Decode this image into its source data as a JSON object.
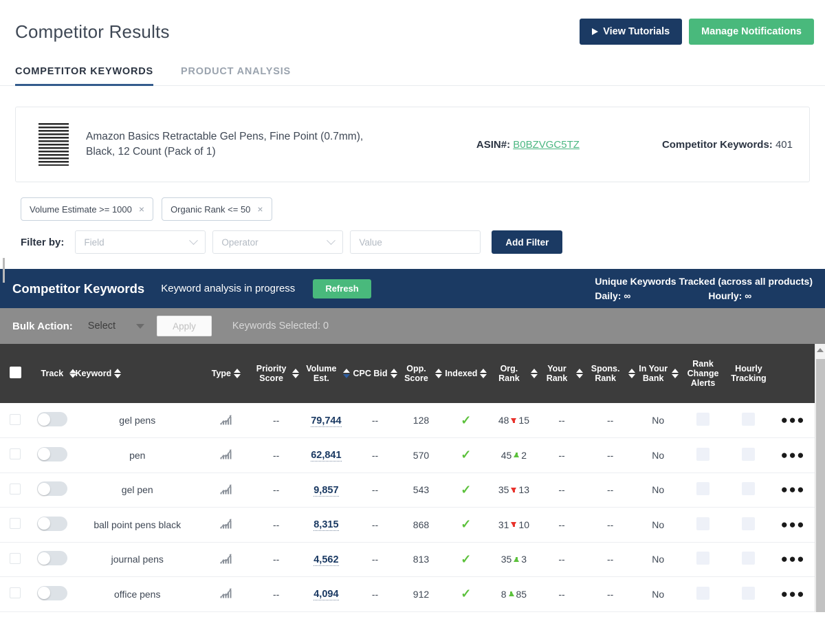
{
  "header": {
    "title": "Competitor Results",
    "tutorials_label": "View Tutorials",
    "notifications_label": "Manage Notifications"
  },
  "tabs": [
    {
      "label": "COMPETITOR KEYWORDS",
      "active": true
    },
    {
      "label": "PRODUCT ANALYSIS",
      "active": false
    }
  ],
  "product": {
    "title": "Amazon Basics Retractable Gel Pens, Fine Point (0.7mm), Black, 12 Count (Pack of 1)",
    "asin_label": "ASIN#:",
    "asin_value": "B0BZVGC5TZ",
    "keywords_label": "Competitor Keywords:",
    "keywords_value": "401"
  },
  "filters": {
    "chips": [
      {
        "label": "Volume Estimate >= 1000",
        "close": "×"
      },
      {
        "label": "Organic Rank <= 50",
        "close": "×"
      }
    ],
    "filter_by_label": "Filter by:",
    "field_placeholder": "Field",
    "operator_placeholder": "Operator",
    "value_placeholder": "Value",
    "add_filter_label": "Add Filter"
  },
  "blue_bar": {
    "title": "Competitor Keywords",
    "status": "Keyword analysis in progress",
    "refresh_label": "Refresh",
    "tracked_title": "Unique Keywords Tracked (across all products)",
    "daily_label": "Daily:",
    "daily_value": "∞",
    "hourly_label": "Hourly:",
    "hourly_value": "∞"
  },
  "bulk_bar": {
    "label": "Bulk Action:",
    "select_value": "Select",
    "apply_label": "Apply",
    "selected_text": "Keywords Selected: 0"
  },
  "table": {
    "columns": [
      {
        "key": "check",
        "label": "",
        "sortable": false
      },
      {
        "key": "track",
        "label": "Track",
        "sortable": false
      },
      {
        "key": "keyword",
        "label": "Keyword",
        "sortable": true
      },
      {
        "key": "type",
        "label": "Type",
        "sortable": true
      },
      {
        "key": "priority",
        "label": "Priority Score",
        "sortable": true
      },
      {
        "key": "volume",
        "label": "Volume Est.",
        "sortable": true,
        "sort_active": "desc"
      },
      {
        "key": "cpc",
        "label": "CPC Bid",
        "sortable": true
      },
      {
        "key": "opp",
        "label": "Opp. Score",
        "sortable": true
      },
      {
        "key": "indexed",
        "label": "Indexed",
        "sortable": true
      },
      {
        "key": "orgrank",
        "label": "Org. Rank",
        "sortable": true
      },
      {
        "key": "yourrank",
        "label": "Your Rank",
        "sortable": true
      },
      {
        "key": "spons",
        "label": "Spons. Rank",
        "sortable": true
      },
      {
        "key": "inbank",
        "label": "In Your Bank",
        "sortable": true
      },
      {
        "key": "alerts",
        "label": "Rank Change Alerts",
        "sortable": false
      },
      {
        "key": "hourly",
        "label": "Hourly Tracking",
        "sortable": false
      },
      {
        "key": "menu",
        "label": "",
        "sortable": false
      }
    ],
    "rows": [
      {
        "keyword": "gel pens",
        "type_icon": "trend-icon",
        "priority": "--",
        "volume": "79,744",
        "cpc": "--",
        "opp": "128",
        "indexed": "✓",
        "org_rank": "48",
        "rank_delta": "15",
        "rank_dir": "down",
        "your_rank": "--",
        "spons_rank": "--",
        "in_bank": "No"
      },
      {
        "keyword": "pen",
        "type_icon": "trend-icon",
        "priority": "--",
        "volume": "62,841",
        "cpc": "--",
        "opp": "570",
        "indexed": "✓",
        "org_rank": "45",
        "rank_delta": "2",
        "rank_dir": "up",
        "your_rank": "--",
        "spons_rank": "--",
        "in_bank": "No"
      },
      {
        "keyword": "gel pen",
        "type_icon": "trend-icon",
        "priority": "--",
        "volume": "9,857",
        "cpc": "--",
        "opp": "543",
        "indexed": "✓",
        "org_rank": "35",
        "rank_delta": "13",
        "rank_dir": "down",
        "your_rank": "--",
        "spons_rank": "--",
        "in_bank": "No"
      },
      {
        "keyword": "ball point pens black",
        "type_icon": "trend-icon",
        "priority": "--",
        "volume": "8,315",
        "cpc": "--",
        "opp": "868",
        "indexed": "✓",
        "org_rank": "31",
        "rank_delta": "10",
        "rank_dir": "down",
        "your_rank": "--",
        "spons_rank": "--",
        "in_bank": "No"
      },
      {
        "keyword": "journal pens",
        "type_icon": "trend-icon",
        "priority": "--",
        "volume": "4,562",
        "cpc": "--",
        "opp": "813",
        "indexed": "✓",
        "org_rank": "35",
        "rank_delta": "3",
        "rank_dir": "up",
        "your_rank": "--",
        "spons_rank": "--",
        "in_bank": "No"
      },
      {
        "keyword": "office pens",
        "type_icon": "trend-icon",
        "priority": "--",
        "volume": "4,094",
        "cpc": "--",
        "opp": "912",
        "indexed": "✓",
        "org_rank": "8",
        "rank_delta": "85",
        "rank_dir": "up",
        "your_rank": "--",
        "spons_rank": "--",
        "in_bank": "No"
      }
    ],
    "row_menu_glyph": "●●●"
  },
  "colors": {
    "navy": "#1b3a63",
    "green": "#49b97c",
    "link_green": "#4cb782",
    "header_dark": "#3c3c3c",
    "bulk_grey": "#8c8c8c",
    "up_green": "#5cc13c",
    "down_red": "#e8322c",
    "sort_active_blue": "#2d5c9e"
  }
}
